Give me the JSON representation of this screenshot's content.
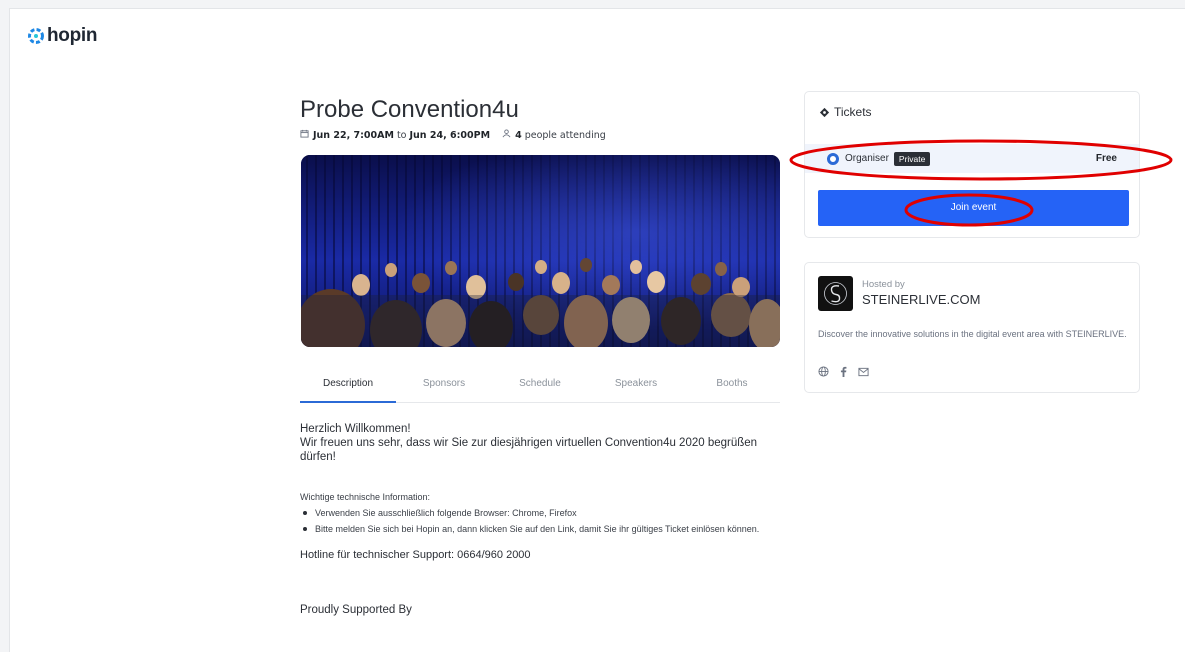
{
  "brand": {
    "logo_text": "hopin",
    "accent": "#2563f6"
  },
  "event": {
    "title": "Probe Convention4u",
    "date_start": "Jun 22, 7:00AM",
    "date_to": "to",
    "date_end": "Jun 24, 6:00PM",
    "attending_count": "4",
    "attending_label": "people attending"
  },
  "tabs": [
    {
      "label": "Description",
      "active": true
    },
    {
      "label": "Sponsors"
    },
    {
      "label": "Schedule"
    },
    {
      "label": "Speakers"
    },
    {
      "label": "Booths"
    }
  ],
  "description": {
    "greeting_line1": "Herzlich Willkommen!",
    "greeting_line2": "Wir freuen uns sehr, dass wir Sie zur diesjährigen virtuellen Convention4u 2020 begrüßen dürfen!",
    "tech_heading": "Wichtige technische Information:",
    "bullets": [
      "Verwenden Sie ausschließlich folgende Browser: Chrome, Firefox",
      "Bitte melden Sie sich bei Hopin an, dann klicken Sie auf den Link, damit Sie ihr gültiges Ticket einlösen können."
    ],
    "hotline": "Hotline für technischer Support:  0664/960 2000",
    "supported_by": "Proudly Supported By"
  },
  "tickets": {
    "heading": "Tickets",
    "ticket_name": "Organiser",
    "ticket_badge": "Private",
    "ticket_price": "Free",
    "join_label": "Join event"
  },
  "host": {
    "hosted_by": "Hosted by",
    "name": "STEINERLIVE.COM",
    "description": "Discover the innovative solutions in the digital event area with STEINERLIVE.",
    "icons": [
      "globe-icon",
      "facebook-icon",
      "mail-icon"
    ]
  },
  "annotation_color": "#e00000"
}
